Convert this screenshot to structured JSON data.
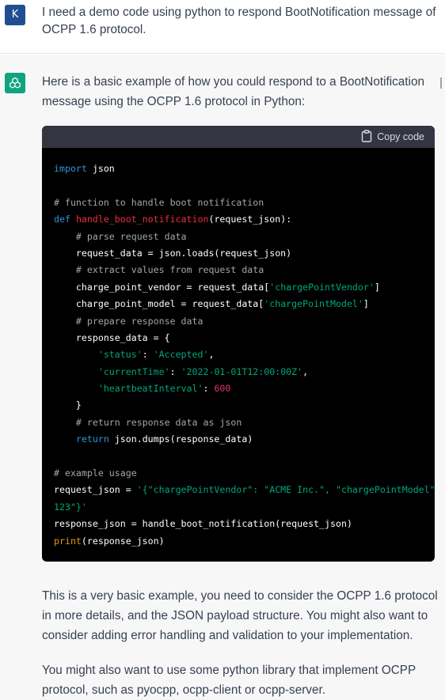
{
  "user_message": {
    "avatar_letter": "K",
    "text": "I need a demo code using python to respond BootNotification message of OCPP 1.6 protocol."
  },
  "assistant_message": {
    "intro": "Here is a basic example of how you could respond to a BootNotification message using the OCPP 1.6 protocol in Python:",
    "copy_label": "Copy code",
    "code_lines": [
      [
        {
          "t": "import",
          "c": "kw"
        },
        {
          "t": " json",
          "c": ""
        }
      ],
      [],
      [
        {
          "t": "# function to handle boot notification",
          "c": "cm"
        }
      ],
      [
        {
          "t": "def",
          "c": "kw"
        },
        {
          "t": " ",
          "c": ""
        },
        {
          "t": "handle_boot_notification",
          "c": "fn"
        },
        {
          "t": "(request_json):",
          "c": ""
        }
      ],
      [
        {
          "t": "    ",
          "c": ""
        },
        {
          "t": "# parse request data",
          "c": "cm"
        }
      ],
      [
        {
          "t": "    request_data = json.loads(request_json)",
          "c": ""
        }
      ],
      [
        {
          "t": "    ",
          "c": ""
        },
        {
          "t": "# extract values from request data",
          "c": "cm"
        }
      ],
      [
        {
          "t": "    charge_point_vendor = request_data[",
          "c": ""
        },
        {
          "t": "'chargePointVendor'",
          "c": "st"
        },
        {
          "t": "]",
          "c": ""
        }
      ],
      [
        {
          "t": "    charge_point_model = request_data[",
          "c": ""
        },
        {
          "t": "'chargePointModel'",
          "c": "st"
        },
        {
          "t": "]",
          "c": ""
        }
      ],
      [
        {
          "t": "    ",
          "c": ""
        },
        {
          "t": "# prepare response data",
          "c": "cm"
        }
      ],
      [
        {
          "t": "    response_data = {",
          "c": ""
        }
      ],
      [
        {
          "t": "        ",
          "c": ""
        },
        {
          "t": "'status'",
          "c": "st"
        },
        {
          "t": ": ",
          "c": ""
        },
        {
          "t": "'Accepted'",
          "c": "st"
        },
        {
          "t": ",",
          "c": ""
        }
      ],
      [
        {
          "t": "        ",
          "c": ""
        },
        {
          "t": "'currentTime'",
          "c": "st"
        },
        {
          "t": ": ",
          "c": ""
        },
        {
          "t": "'2022-01-01T12:00:00Z'",
          "c": "st"
        },
        {
          "t": ",",
          "c": ""
        }
      ],
      [
        {
          "t": "        ",
          "c": ""
        },
        {
          "t": "'heartbeatInterval'",
          "c": "st"
        },
        {
          "t": ": ",
          "c": ""
        },
        {
          "t": "600",
          "c": "nm"
        }
      ],
      [
        {
          "t": "    }",
          "c": ""
        }
      ],
      [
        {
          "t": "    ",
          "c": ""
        },
        {
          "t": "# return response data as json",
          "c": "cm"
        }
      ],
      [
        {
          "t": "    ",
          "c": ""
        },
        {
          "t": "return",
          "c": "kw"
        },
        {
          "t": " json.dumps(response_data)",
          "c": ""
        }
      ],
      [],
      [
        {
          "t": "# example usage",
          "c": "cm"
        }
      ],
      [
        {
          "t": "request_json = ",
          "c": ""
        },
        {
          "t": "'{\"chargePointVendor\": \"ACME Inc.\", \"chargePointModel\": \"CP-",
          "c": "st"
        }
      ],
      [
        {
          "t": "123\"}'",
          "c": "st"
        }
      ],
      [
        {
          "t": "response_json = handle_boot_notification(request_json)",
          "c": ""
        }
      ],
      [
        {
          "t": "print",
          "c": "bi"
        },
        {
          "t": "(response_json)",
          "c": ""
        }
      ]
    ],
    "paragraph_1": "This is a very basic example, you need to consider the OCPP 1.6 protocol in more details, and the JSON payload structure. You might also want to consider adding error handling and validation to your implementation.",
    "paragraph_2": "You might also want to use some python library that implement OCPP protocol, such as pyocpp, ocpp-client or ocpp-server."
  },
  "icons": {
    "user_avatar": "letter-avatar",
    "assistant_avatar": "openai-logo-icon",
    "copy": "clipboard-icon"
  },
  "colors": {
    "user_avatar_bg": "#1f4f8f",
    "assistant_avatar_bg": "#10a37f",
    "assistant_bg": "#f7f7f8",
    "code_bg": "#000000",
    "code_header_bg": "#343541"
  }
}
